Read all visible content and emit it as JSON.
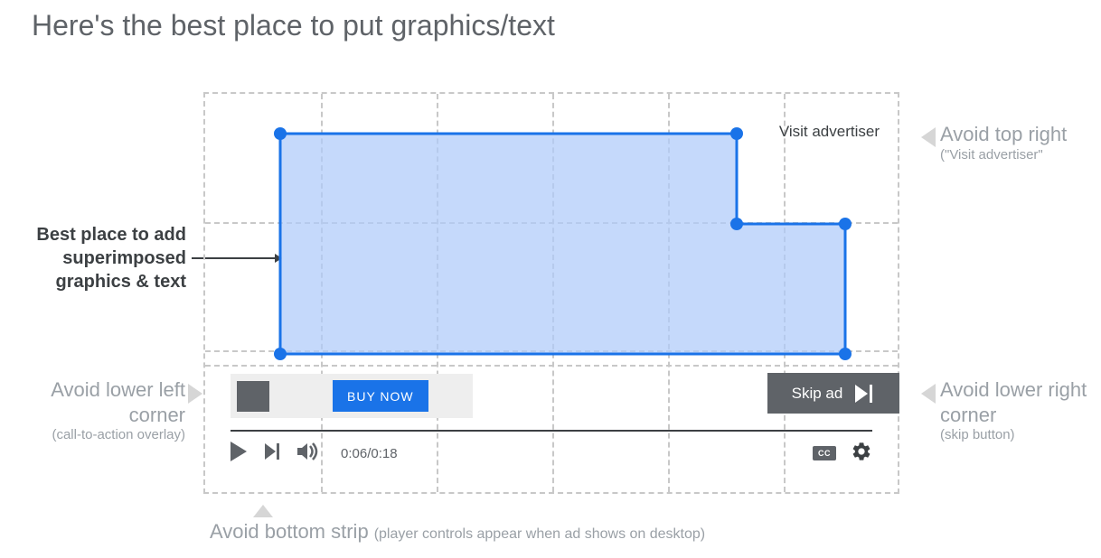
{
  "title": "Here's the best place to put graphics/text",
  "visit_advertiser": "Visit advertiser",
  "cta": {
    "buy_now": "BUY NOW"
  },
  "skip_ad": "Skip ad",
  "controls": {
    "time": "0:06/0:18",
    "cc": "CC"
  },
  "annotations": {
    "best_place": "Best place to add superimposed graphics & text",
    "top_right": "Avoid top right",
    "top_right_sub": "(\"Visit advertiser\"",
    "lower_left": "Avoid lower left corner",
    "lower_left_sub": "(call-to-action overlay)",
    "lower_right": "Avoid lower right corner",
    "lower_right_sub": "(skip button)",
    "bottom": "Avoid bottom strip",
    "bottom_sub": "(player controls appear when ad shows on desktop)"
  }
}
